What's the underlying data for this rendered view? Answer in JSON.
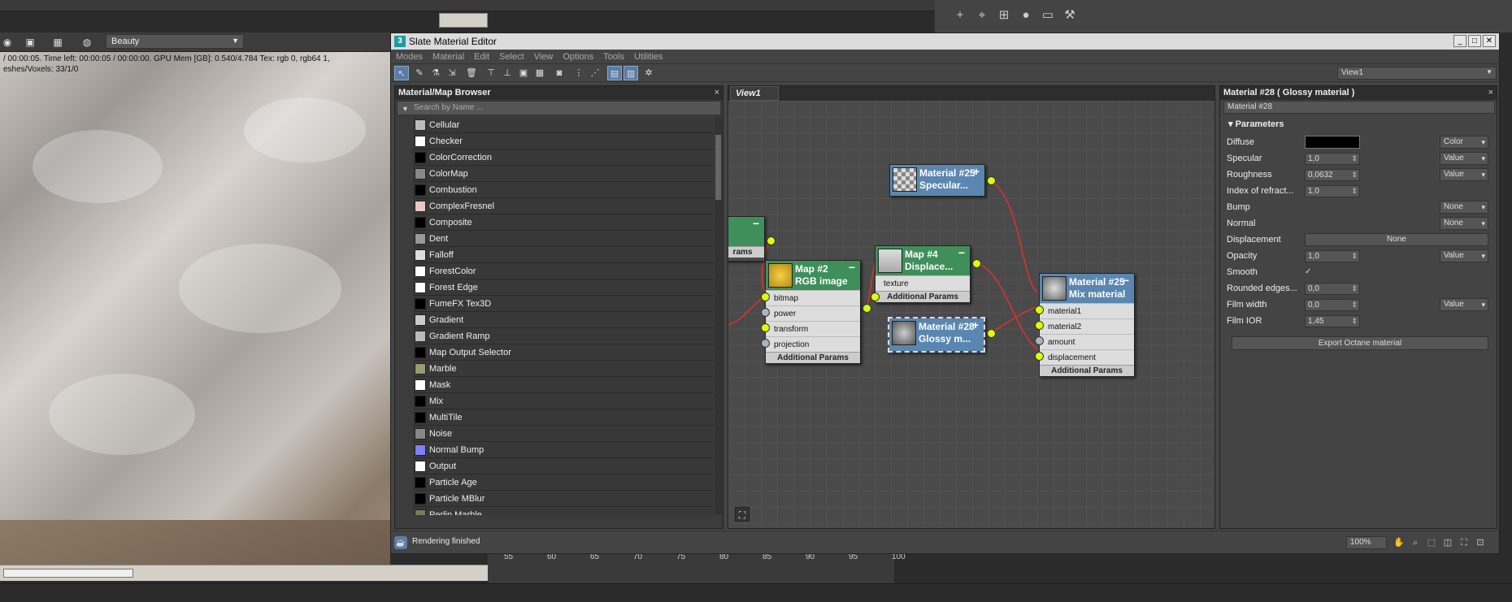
{
  "viewport": {
    "render_pass": "Beauty",
    "status_line1": "/ 00:00:05.   Time left: 00:00:05 / 00:00:00.   GPU Mem [GB]: 0.540/4.784   Tex: rgb 0, rgb64 1,",
    "status_line2": "eshes/Voxels: 33/1/0"
  },
  "timeline": {
    "ticks": [
      "55",
      "60",
      "65",
      "70",
      "75",
      "80",
      "85",
      "90",
      "95",
      "100"
    ]
  },
  "window": {
    "title": "Slate Material Editor",
    "logo": "3"
  },
  "menu": [
    "Modes",
    "Material",
    "Edit",
    "Select",
    "View",
    "Options",
    "Tools",
    "Utilities"
  ],
  "view_selector": "View1",
  "browser": {
    "title": "Material/Map Browser",
    "search_placeholder": "Search by Name ...",
    "items": [
      {
        "label": "Cellular",
        "color": "#bbb"
      },
      {
        "label": "Checker",
        "color": "#fff"
      },
      {
        "label": "ColorCorrection",
        "color": "#000"
      },
      {
        "label": "ColorMap",
        "color": "#888"
      },
      {
        "label": "Combustion",
        "color": "#000"
      },
      {
        "label": "ComplexFresnel",
        "color": "#e8c8c0"
      },
      {
        "label": "Composite",
        "color": "#000"
      },
      {
        "label": "Dent",
        "color": "#999"
      },
      {
        "label": "Falloff",
        "color": "#ddd"
      },
      {
        "label": "ForestColor",
        "color": "#fff"
      },
      {
        "label": "Forest Edge",
        "color": "#fff"
      },
      {
        "label": "FumeFX Tex3D",
        "color": "#000"
      },
      {
        "label": "Gradient",
        "color": "#ccc"
      },
      {
        "label": "Gradient Ramp",
        "color": "#bbb"
      },
      {
        "label": "Map Output Selector",
        "color": "#000"
      },
      {
        "label": "Marble",
        "color": "#9a9a70"
      },
      {
        "label": "Mask",
        "color": "#fff"
      },
      {
        "label": "Mix",
        "color": "#000"
      },
      {
        "label": "MultiTile",
        "color": "#000"
      },
      {
        "label": "Noise",
        "color": "#888"
      },
      {
        "label": "Normal Bump",
        "color": "#8080ff"
      },
      {
        "label": "Output",
        "color": "#fff"
      },
      {
        "label": "Particle Age",
        "color": "#000"
      },
      {
        "label": "Particle MBlur",
        "color": "#000"
      },
      {
        "label": "Perlin Marble",
        "color": "#7a7a60"
      }
    ]
  },
  "view_tab": "View1",
  "nodes": {
    "partial": {
      "addp": "rams"
    },
    "rgb": {
      "title1": "Map #2",
      "title2": "RGB image",
      "slots": [
        "bitmap",
        "power",
        "transform",
        "projection"
      ],
      "addp": "Additional Params"
    },
    "specular": {
      "title1": "Material #25",
      "title2": "Specular..."
    },
    "displace": {
      "title1": "Map #4",
      "title2": "Displace...",
      "slots": [
        "texture"
      ],
      "addp": "Additional Params"
    },
    "glossy": {
      "title1": "Material #28",
      "title2": "Glossy m..."
    },
    "mix": {
      "title1": "Material #25",
      "title2": "Mix material",
      "slots": [
        "material1",
        "material2",
        "amount",
        "displacement"
      ],
      "addp": "Additional Params"
    }
  },
  "props": {
    "header": "Material #28  ( Glossy material )",
    "name": "Material #28",
    "rollout": "Parameters",
    "rows": {
      "diffuse": {
        "label": "Diffuse",
        "mode": "Color"
      },
      "specular": {
        "label": "Specular",
        "value": "1,0",
        "mode": "Value"
      },
      "roughness": {
        "label": "Roughness",
        "value": "0,0632",
        "mode": "Value"
      },
      "ior": {
        "label": "Index of refract...",
        "value": "1,0"
      },
      "bump": {
        "label": "Bump",
        "mode": "None"
      },
      "normal": {
        "label": "Normal",
        "mode": "None"
      },
      "displacement": {
        "label": "Displacement",
        "value": "None"
      },
      "opacity": {
        "label": "Opacity",
        "value": "1,0",
        "mode": "Value"
      },
      "smooth": {
        "label": "Smooth",
        "value": "✓"
      },
      "rounded": {
        "label": "Rounded edges...",
        "value": "0,0"
      },
      "filmwidth": {
        "label": "Film width",
        "value": "0,0",
        "mode": "Value"
      },
      "filmior": {
        "label": "Film IOR",
        "value": "1,45"
      }
    },
    "export": "Export Octane material"
  },
  "status": {
    "text": "Rendering finished",
    "zoom": "100%"
  }
}
